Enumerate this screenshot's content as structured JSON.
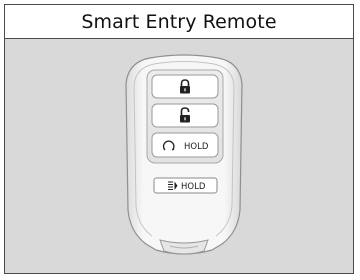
{
  "title": "Smart Entry Remote",
  "buttons": {
    "lock": {
      "icon": "lock-closed-icon"
    },
    "unlock": {
      "icon": "lock-open-icon"
    },
    "remote_start": {
      "icon": "remote-start-icon",
      "label": "HOLD"
    },
    "trunk": {
      "icon": "trunk-open-icon",
      "label": "HOLD"
    }
  },
  "colors": {
    "background": "#d9d9d9",
    "fob_body": "#f3f3f3",
    "button_face": "#ffffff",
    "outline": "#9a9a9a"
  }
}
